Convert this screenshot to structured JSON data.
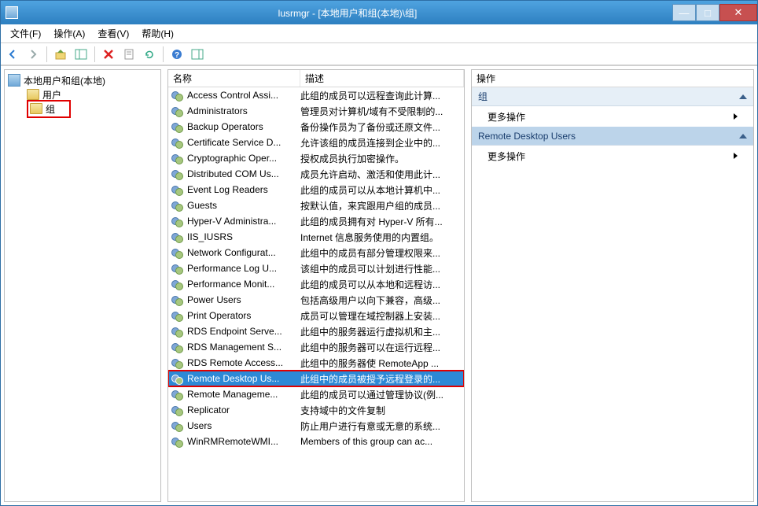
{
  "title": "lusrmgr - [本地用户和组(本地)\\组]",
  "menus": {
    "file": "文件(F)",
    "action": "操作(A)",
    "view": "查看(V)",
    "help": "帮助(H)"
  },
  "tree": {
    "root": "本地用户和组(本地)",
    "users": "用户",
    "groups": "组"
  },
  "list": {
    "col_name": "名称",
    "col_desc": "描述",
    "selected_index": 17,
    "rows": [
      {
        "name": "Access Control Assi...",
        "desc": "此组的成员可以远程查询此计算..."
      },
      {
        "name": "Administrators",
        "desc": "管理员对计算机/域有不受限制的..."
      },
      {
        "name": "Backup Operators",
        "desc": "备份操作员为了备份或还原文件..."
      },
      {
        "name": "Certificate Service D...",
        "desc": "允许该组的成员连接到企业中的..."
      },
      {
        "name": "Cryptographic Oper...",
        "desc": "授权成员执行加密操作。"
      },
      {
        "name": "Distributed COM Us...",
        "desc": "成员允许启动、激活和使用此计..."
      },
      {
        "name": "Event Log Readers",
        "desc": "此组的成员可以从本地计算机中..."
      },
      {
        "name": "Guests",
        "desc": "按默认值，来宾跟用户组的成员..."
      },
      {
        "name": "Hyper-V Administra...",
        "desc": "此组的成员拥有对 Hyper-V 所有..."
      },
      {
        "name": "IIS_IUSRS",
        "desc": "Internet 信息服务使用的内置组。"
      },
      {
        "name": "Network Configurat...",
        "desc": "此组中的成员有部分管理权限来..."
      },
      {
        "name": "Performance Log U...",
        "desc": "该组中的成员可以计划进行性能..."
      },
      {
        "name": "Performance Monit...",
        "desc": "此组的成员可以从本地和远程访..."
      },
      {
        "name": "Power Users",
        "desc": "包括高级用户以向下兼容，高级..."
      },
      {
        "name": "Print Operators",
        "desc": "成员可以管理在域控制器上安装..."
      },
      {
        "name": "RDS Endpoint Serve...",
        "desc": "此组中的服务器运行虚拟机和主..."
      },
      {
        "name": "RDS Management S...",
        "desc": "此组中的服务器可以在运行远程..."
      },
      {
        "name": "RDS Remote Access...",
        "desc": "此组中的服务器使 RemoteApp ..."
      },
      {
        "name": "Remote Desktop Us...",
        "desc": "此组中的成员被授予远程登录的..."
      },
      {
        "name": "Remote Manageme...",
        "desc": "此组的成员可以通过管理协议(例..."
      },
      {
        "name": "Replicator",
        "desc": "支持域中的文件复制"
      },
      {
        "name": "Users",
        "desc": "防止用户进行有意或无意的系统..."
      },
      {
        "name": "WinRMRemoteWMI...",
        "desc": "Members of this group can ac..."
      }
    ]
  },
  "actions": {
    "header": "操作",
    "section1": "组",
    "more": "更多操作",
    "section2": "Remote Desktop Users"
  }
}
